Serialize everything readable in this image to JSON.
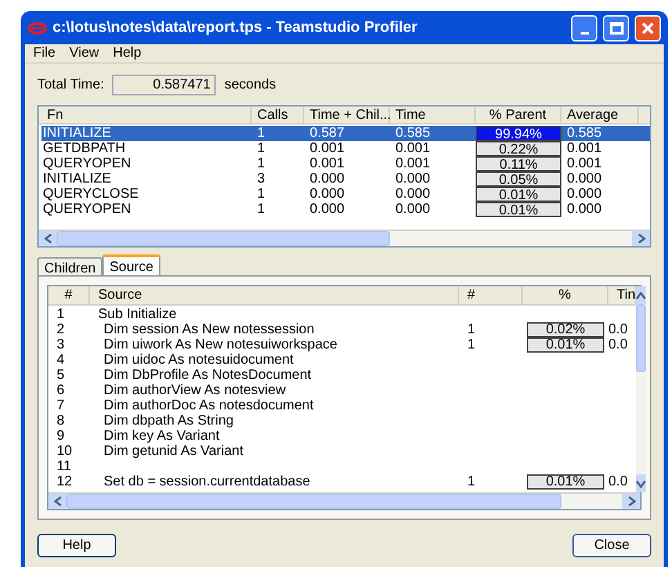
{
  "window": {
    "title": "c:\\lotus\\notes\\data\\report.tps - Teamstudio Profiler"
  },
  "menu": [
    "File",
    "View",
    "Help"
  ],
  "total_time": {
    "label": "Total Time:",
    "value": "0.587471",
    "unit": "seconds"
  },
  "functions": {
    "columns": [
      "Fn",
      "Calls",
      "Time + Chil...",
      "Time",
      "% Parent",
      "Average"
    ],
    "rows": [
      {
        "fn": "INITIALIZE",
        "calls": "1",
        "time_children": "0.587",
        "time": "0.585",
        "parent": "99.94%",
        "average": "0.585",
        "selected": true
      },
      {
        "fn": "GETDBPATH",
        "calls": "1",
        "time_children": "0.001",
        "time": "0.001",
        "parent": "0.22%",
        "average": "0.001",
        "selected": false
      },
      {
        "fn": "QUERYOPEN",
        "calls": "1",
        "time_children": "0.001",
        "time": "0.001",
        "parent": "0.11%",
        "average": "0.001",
        "selected": false
      },
      {
        "fn": "INITIALIZE",
        "calls": "3",
        "time_children": "0.000",
        "time": "0.000",
        "parent": "0.05%",
        "average": "0.000",
        "selected": false
      },
      {
        "fn": "QUERYCLOSE",
        "calls": "1",
        "time_children": "0.000",
        "time": "0.000",
        "parent": "0.01%",
        "average": "0.000",
        "selected": false
      },
      {
        "fn": "QUERYOPEN",
        "calls": "1",
        "time_children": "0.000",
        "time": "0.000",
        "parent": "0.01%",
        "average": "0.000",
        "selected": false
      }
    ]
  },
  "tabs": [
    {
      "label": "Children",
      "selected": false
    },
    {
      "label": "Source",
      "selected": true
    }
  ],
  "source": {
    "columns": [
      "#",
      "Source",
      "#",
      "%",
      "Tin"
    ],
    "rows": [
      {
        "line": "1",
        "kind": "sub",
        "code": "Sub Initialize"
      },
      {
        "line": "2",
        "kind": "statement",
        "code": "Dim session As New notessession",
        "count": "1",
        "percent": "0.02%",
        "time": "0.0"
      },
      {
        "line": "3",
        "kind": "statement",
        "code": "Dim uiwork As New notesuiworkspace",
        "count": "1",
        "percent": "0.01%",
        "time": "0.0"
      },
      {
        "line": "4",
        "kind": "statement",
        "code": "Dim uidoc As notesuidocument"
      },
      {
        "line": "5",
        "kind": "statement",
        "code": "Dim DbProfile As NotesDocument"
      },
      {
        "line": "6",
        "kind": "statement",
        "code": "Dim authorView As notesview"
      },
      {
        "line": "7",
        "kind": "statement",
        "code": "Dim authorDoc As notesdocument"
      },
      {
        "line": "8",
        "kind": "statement",
        "code": "Dim dbpath As String"
      },
      {
        "line": "9",
        "kind": "statement",
        "code": "Dim key As Variant"
      },
      {
        "line": "10",
        "kind": "statement",
        "code": "Dim getunid As Variant"
      },
      {
        "line": "11",
        "kind": "statement",
        "code": ""
      },
      {
        "line": "12",
        "kind": "statement",
        "code": "Set db = session.currentdatabase",
        "count": "1",
        "percent": "0.01%",
        "time": "0.0"
      }
    ]
  },
  "buttons": [
    "Help",
    "Close"
  ]
}
